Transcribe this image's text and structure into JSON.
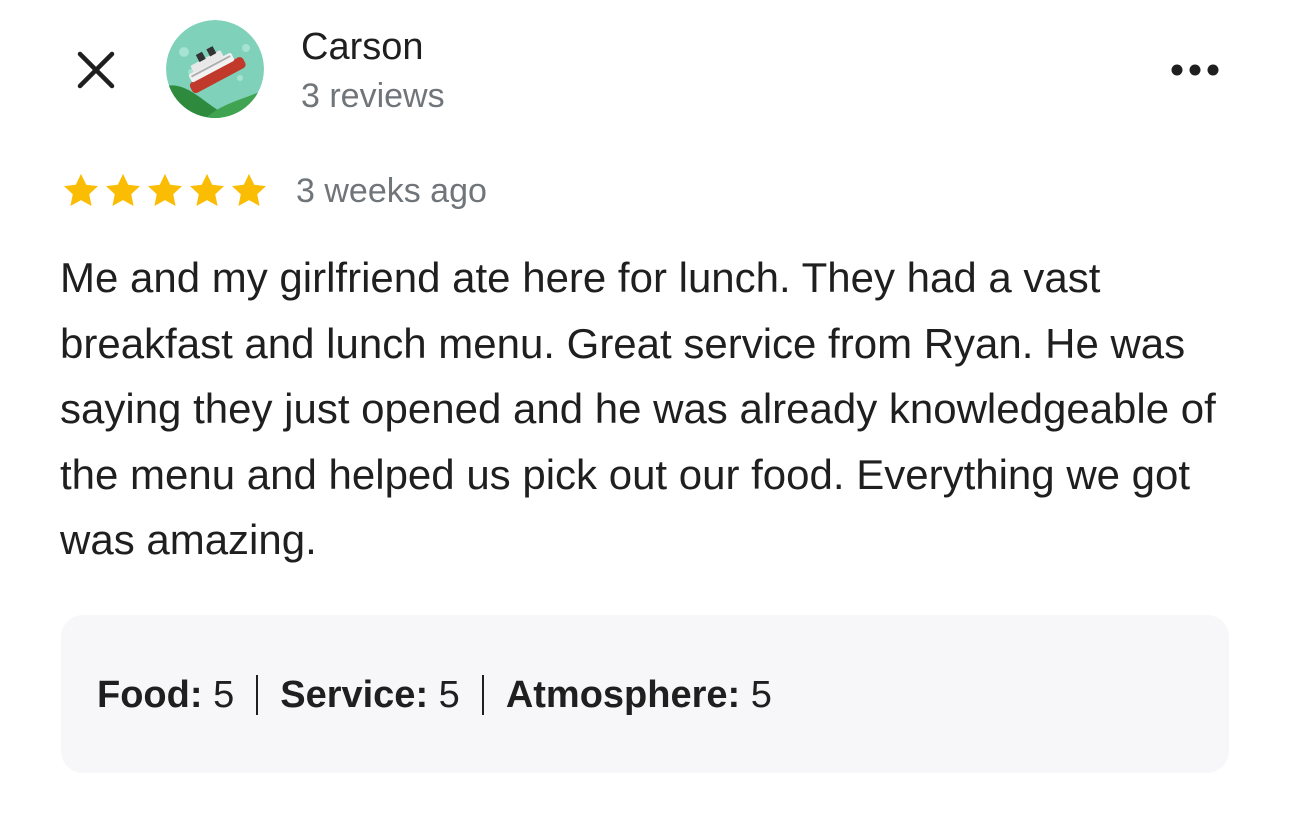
{
  "review": {
    "author": {
      "name": "Carson",
      "reviews_count": "3 reviews",
      "avatar_icon": "cruise-ship-avatar"
    },
    "rating": 5,
    "rating_max": 5,
    "star_color": "#fbbc04",
    "time": "3 weeks ago",
    "text": "Me and my girlfriend ate here for lunch. They had a vast breakfast and lunch menu. Great service from Ryan. He was saying they just opened and he was already knowledgeable of the menu and helped us pick out our food. Everything we got was amazing.",
    "ratings": {
      "food_label": "Food:",
      "food_value": "5",
      "service_label": "Service:",
      "service_value": "5",
      "atmosphere_label": "Atmosphere:",
      "atmosphere_value": "5"
    }
  },
  "controls": {
    "close_icon": "close-icon",
    "more_icon": "more-horizontal-icon"
  },
  "colors": {
    "text_primary": "#1f1f1f",
    "text_secondary": "#70757a",
    "ratings_box_bg": "#f7f7f9"
  }
}
